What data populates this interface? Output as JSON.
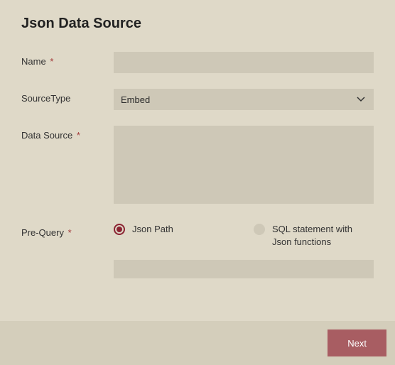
{
  "title": "Json Data Source",
  "fields": {
    "name": {
      "label": "Name",
      "required": true,
      "value": ""
    },
    "sourceType": {
      "label": "SourceType",
      "required": false,
      "selected": "Embed"
    },
    "dataSource": {
      "label": "Data Source",
      "required": true,
      "value": ""
    },
    "preQuery": {
      "label": "Pre-Query",
      "required": true,
      "options": [
        {
          "label": "Json Path",
          "selected": true
        },
        {
          "label": "SQL statement with Json functions",
          "selected": false
        }
      ],
      "value": ""
    }
  },
  "footer": {
    "next": "Next"
  },
  "requiredMark": "*"
}
